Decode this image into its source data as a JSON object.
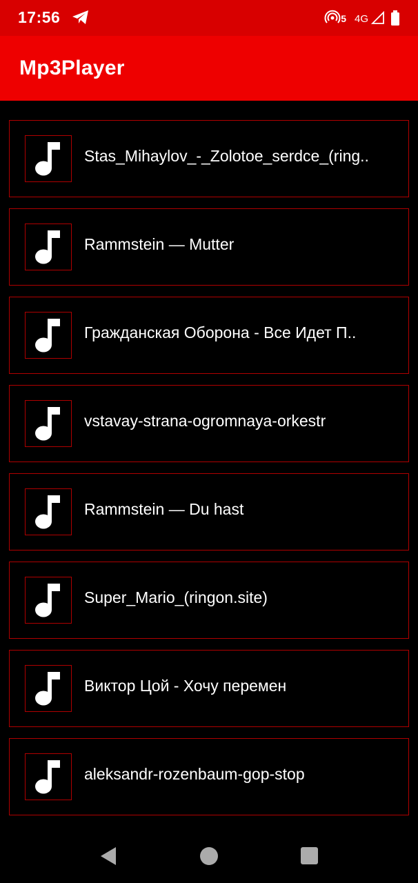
{
  "status_bar": {
    "time": "17:56",
    "hotspot_count": "5",
    "network_type": "4G",
    "icons": [
      "telegram-icon",
      "hotspot-icon",
      "signal-icon",
      "battery-icon"
    ]
  },
  "app_bar": {
    "title": "Mp3Player",
    "color": "#ee0000"
  },
  "songs": [
    {
      "title": "Stas_Mihaylov_-_Zolotoe_serdce_(ring..",
      "icon": "music-note-icon"
    },
    {
      "title": "Rammstein — Mutter",
      "icon": "music-note-icon"
    },
    {
      "title": "Гражданская Оборона - Все Идет П..",
      "icon": "music-note-icon"
    },
    {
      "title": "vstavay-strana-ogromnaya-orkestr",
      "icon": "music-note-icon"
    },
    {
      "title": "Rammstein — Du hast",
      "icon": "music-note-icon"
    },
    {
      "title": "Super_Mario_(ringon.site)",
      "icon": "music-note-icon"
    },
    {
      "title": "Виктор Цой - Хочу перемен",
      "icon": "music-note-icon"
    },
    {
      "title": "aleksandr-rozenbaum-gop-stop",
      "icon": "music-note-icon"
    }
  ],
  "nav_bar": {
    "icons": [
      "back-icon",
      "home-icon",
      "recent-apps-icon"
    ]
  },
  "colors": {
    "status_bar": "#d80000",
    "accent": "#ee0000",
    "border": "#b00000",
    "background": "#000000",
    "text": "#ffffff"
  }
}
